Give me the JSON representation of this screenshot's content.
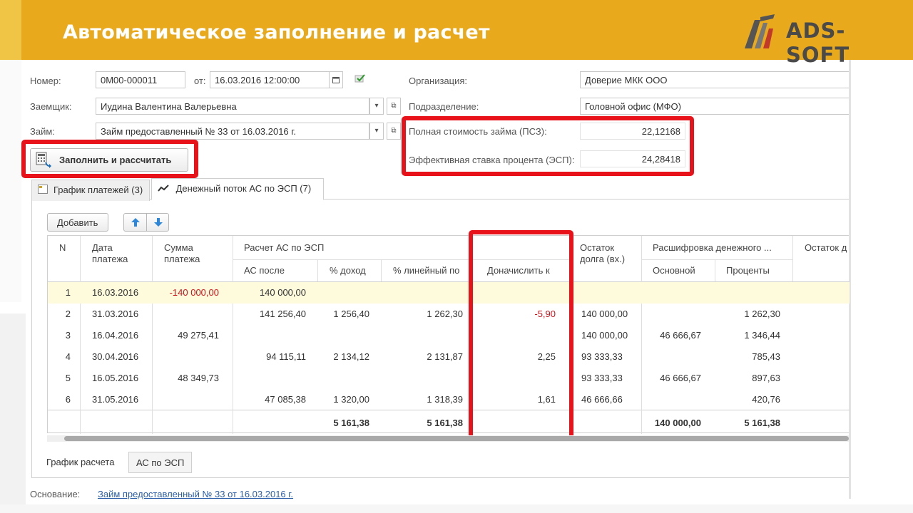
{
  "slide": {
    "title": "Автоматическое заполнение и расчет",
    "logo_text": "ADS-SOFT"
  },
  "form": {
    "number_label": "Номер:",
    "number_value": "0М00-000011",
    "from_label": "от:",
    "date_value": "16.03.2016 12:00:00",
    "borrower_label": "Заемщик:",
    "borrower_value": "Иудина Валентина Валерьевна",
    "loan_label": "Займ:",
    "loan_value": "Займ предоставленный № 33 от 16.03.2016 г.",
    "org_label": "Организация:",
    "org_value": "Доверие МКК ООО",
    "division_label": "Подразделение:",
    "division_value": "Головной офис (МФО)",
    "psk_label": "Полная стоимость займа (ПСЗ):",
    "psk_value": "22,12168",
    "esp_label": "Эффективная ставка процента (ЭСП):",
    "esp_value": "24,28418",
    "fill_button": "Заполнить и рассчитать"
  },
  "tabs": [
    {
      "label": "График платежей (3)"
    },
    {
      "label": "Денежный поток АС по ЭСП (7)"
    }
  ],
  "toolbar": {
    "add_label": "Добавить"
  },
  "table": {
    "headers": {
      "n": "N",
      "date": "Дата платежа",
      "sum": "Сумма платежа",
      "calc_group": "Расчет АС по ЭСП",
      "ac_after": "АС после",
      "pct_income": "% доход",
      "pct_linear": "% линейный по",
      "accrue": "Доначислить к",
      "balance": "Остаток долга (вх.)",
      "cash_group": "Расшифровка денежного ...",
      "principal": "Основной",
      "interest": "Проценты",
      "balance_out": "Остаток д"
    },
    "rows": [
      {
        "n": "1",
        "date": "16.03.2016",
        "sum": "-140 000,00",
        "ac_after": "140 000,00",
        "pct_income": "",
        "pct_linear": "",
        "accrue": "",
        "balance": "",
        "principal": "",
        "interest": ""
      },
      {
        "n": "2",
        "date": "31.03.2016",
        "sum": "",
        "ac_after": "141 256,40",
        "pct_income": "1 256,40",
        "pct_linear": "1 262,30",
        "accrue": "-5,90",
        "balance": "140 000,00",
        "principal": "",
        "interest": "1 262,30"
      },
      {
        "n": "3",
        "date": "16.04.2016",
        "sum": "49 275,41",
        "ac_after": "",
        "pct_income": "",
        "pct_linear": "",
        "accrue": "",
        "balance": "140 000,00",
        "principal": "46 666,67",
        "interest": "1 346,44"
      },
      {
        "n": "4",
        "date": "30.04.2016",
        "sum": "",
        "ac_after": "94 115,11",
        "pct_income": "2 134,12",
        "pct_linear": "2 131,87",
        "accrue": "2,25",
        "balance": "93 333,33",
        "principal": "",
        "interest": "785,43"
      },
      {
        "n": "5",
        "date": "16.05.2016",
        "sum": "48 349,73",
        "ac_after": "",
        "pct_income": "",
        "pct_linear": "",
        "accrue": "",
        "balance": "93 333,33",
        "principal": "46 666,67",
        "interest": "897,63"
      },
      {
        "n": "6",
        "date": "31.05.2016",
        "sum": "",
        "ac_after": "47 085,38",
        "pct_income": "1 320,00",
        "pct_linear": "1 318,39",
        "accrue": "1,61",
        "balance": "46 666,66",
        "principal": "",
        "interest": "420,76"
      }
    ],
    "totals": {
      "pct_income": "5 161,38",
      "pct_linear": "5 161,38",
      "principal": "140 000,00",
      "interest": "5 161,38"
    }
  },
  "bottom_tabs": [
    {
      "label": "График расчета"
    },
    {
      "label": "АС по ЭСП"
    }
  ],
  "footer": {
    "basis_label": "Основание:",
    "basis_link": "Займ предоставленный № 33 от 16.03.2016 г."
  },
  "colors": {
    "header_bg": "#e8aa1c",
    "highlight_red": "#e8121b",
    "selected_row": "#fefbdc",
    "negative": "#d0111a",
    "link": "#2a5ea8"
  }
}
